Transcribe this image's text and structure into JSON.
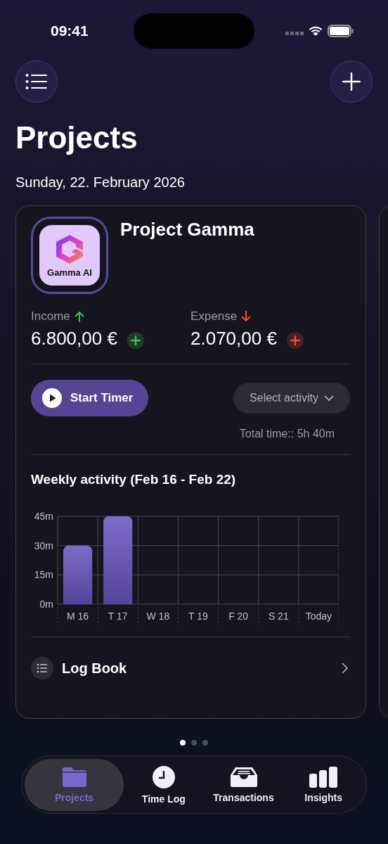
{
  "status_bar": {
    "time": "09:41"
  },
  "header": {
    "title": "Projects",
    "date": "Sunday, 22. February 2026"
  },
  "project": {
    "logo_text": "Gamma AI",
    "name": "Project Gamma",
    "stats": [
      {
        "kind": "income",
        "label": "Income",
        "value": "6.800,00 €"
      },
      {
        "kind": "expense",
        "label": "Expense",
        "value": "2.070,00 €"
      }
    ],
    "timer_button": "Start Timer",
    "activity_select": {
      "placeholder": "Select activity"
    },
    "total_time": "Total time:: 5h 40m",
    "weekly": {
      "title": "Weekly activity (Feb 16 - Feb 22)",
      "chart_data": {
        "type": "bar",
        "categories": [
          "M 16",
          "T 17",
          "W 18",
          "T 19",
          "F 20",
          "S 21",
          "Today"
        ],
        "values": [
          30,
          45,
          0,
          0,
          0,
          0,
          0
        ],
        "ylim": [
          0,
          45
        ],
        "yticks": [
          {
            "value": 0,
            "label": "0m"
          },
          {
            "value": 15,
            "label": "15m"
          },
          {
            "value": 30,
            "label": "30m"
          },
          {
            "value": 45,
            "label": "45m"
          }
        ]
      }
    },
    "log_book": "Log Book"
  },
  "pager": [
    {
      "selected": true
    },
    {
      "selected": false
    },
    {
      "selected": false
    }
  ],
  "tabs": [
    {
      "kind": "folder",
      "label": "Projects",
      "selected": true
    },
    {
      "kind": "clock",
      "label": "Time Log",
      "selected": false
    },
    {
      "kind": "tray",
      "label": "Transactions",
      "selected": false
    },
    {
      "kind": "chart",
      "label": "Insights",
      "selected": false
    }
  ]
}
